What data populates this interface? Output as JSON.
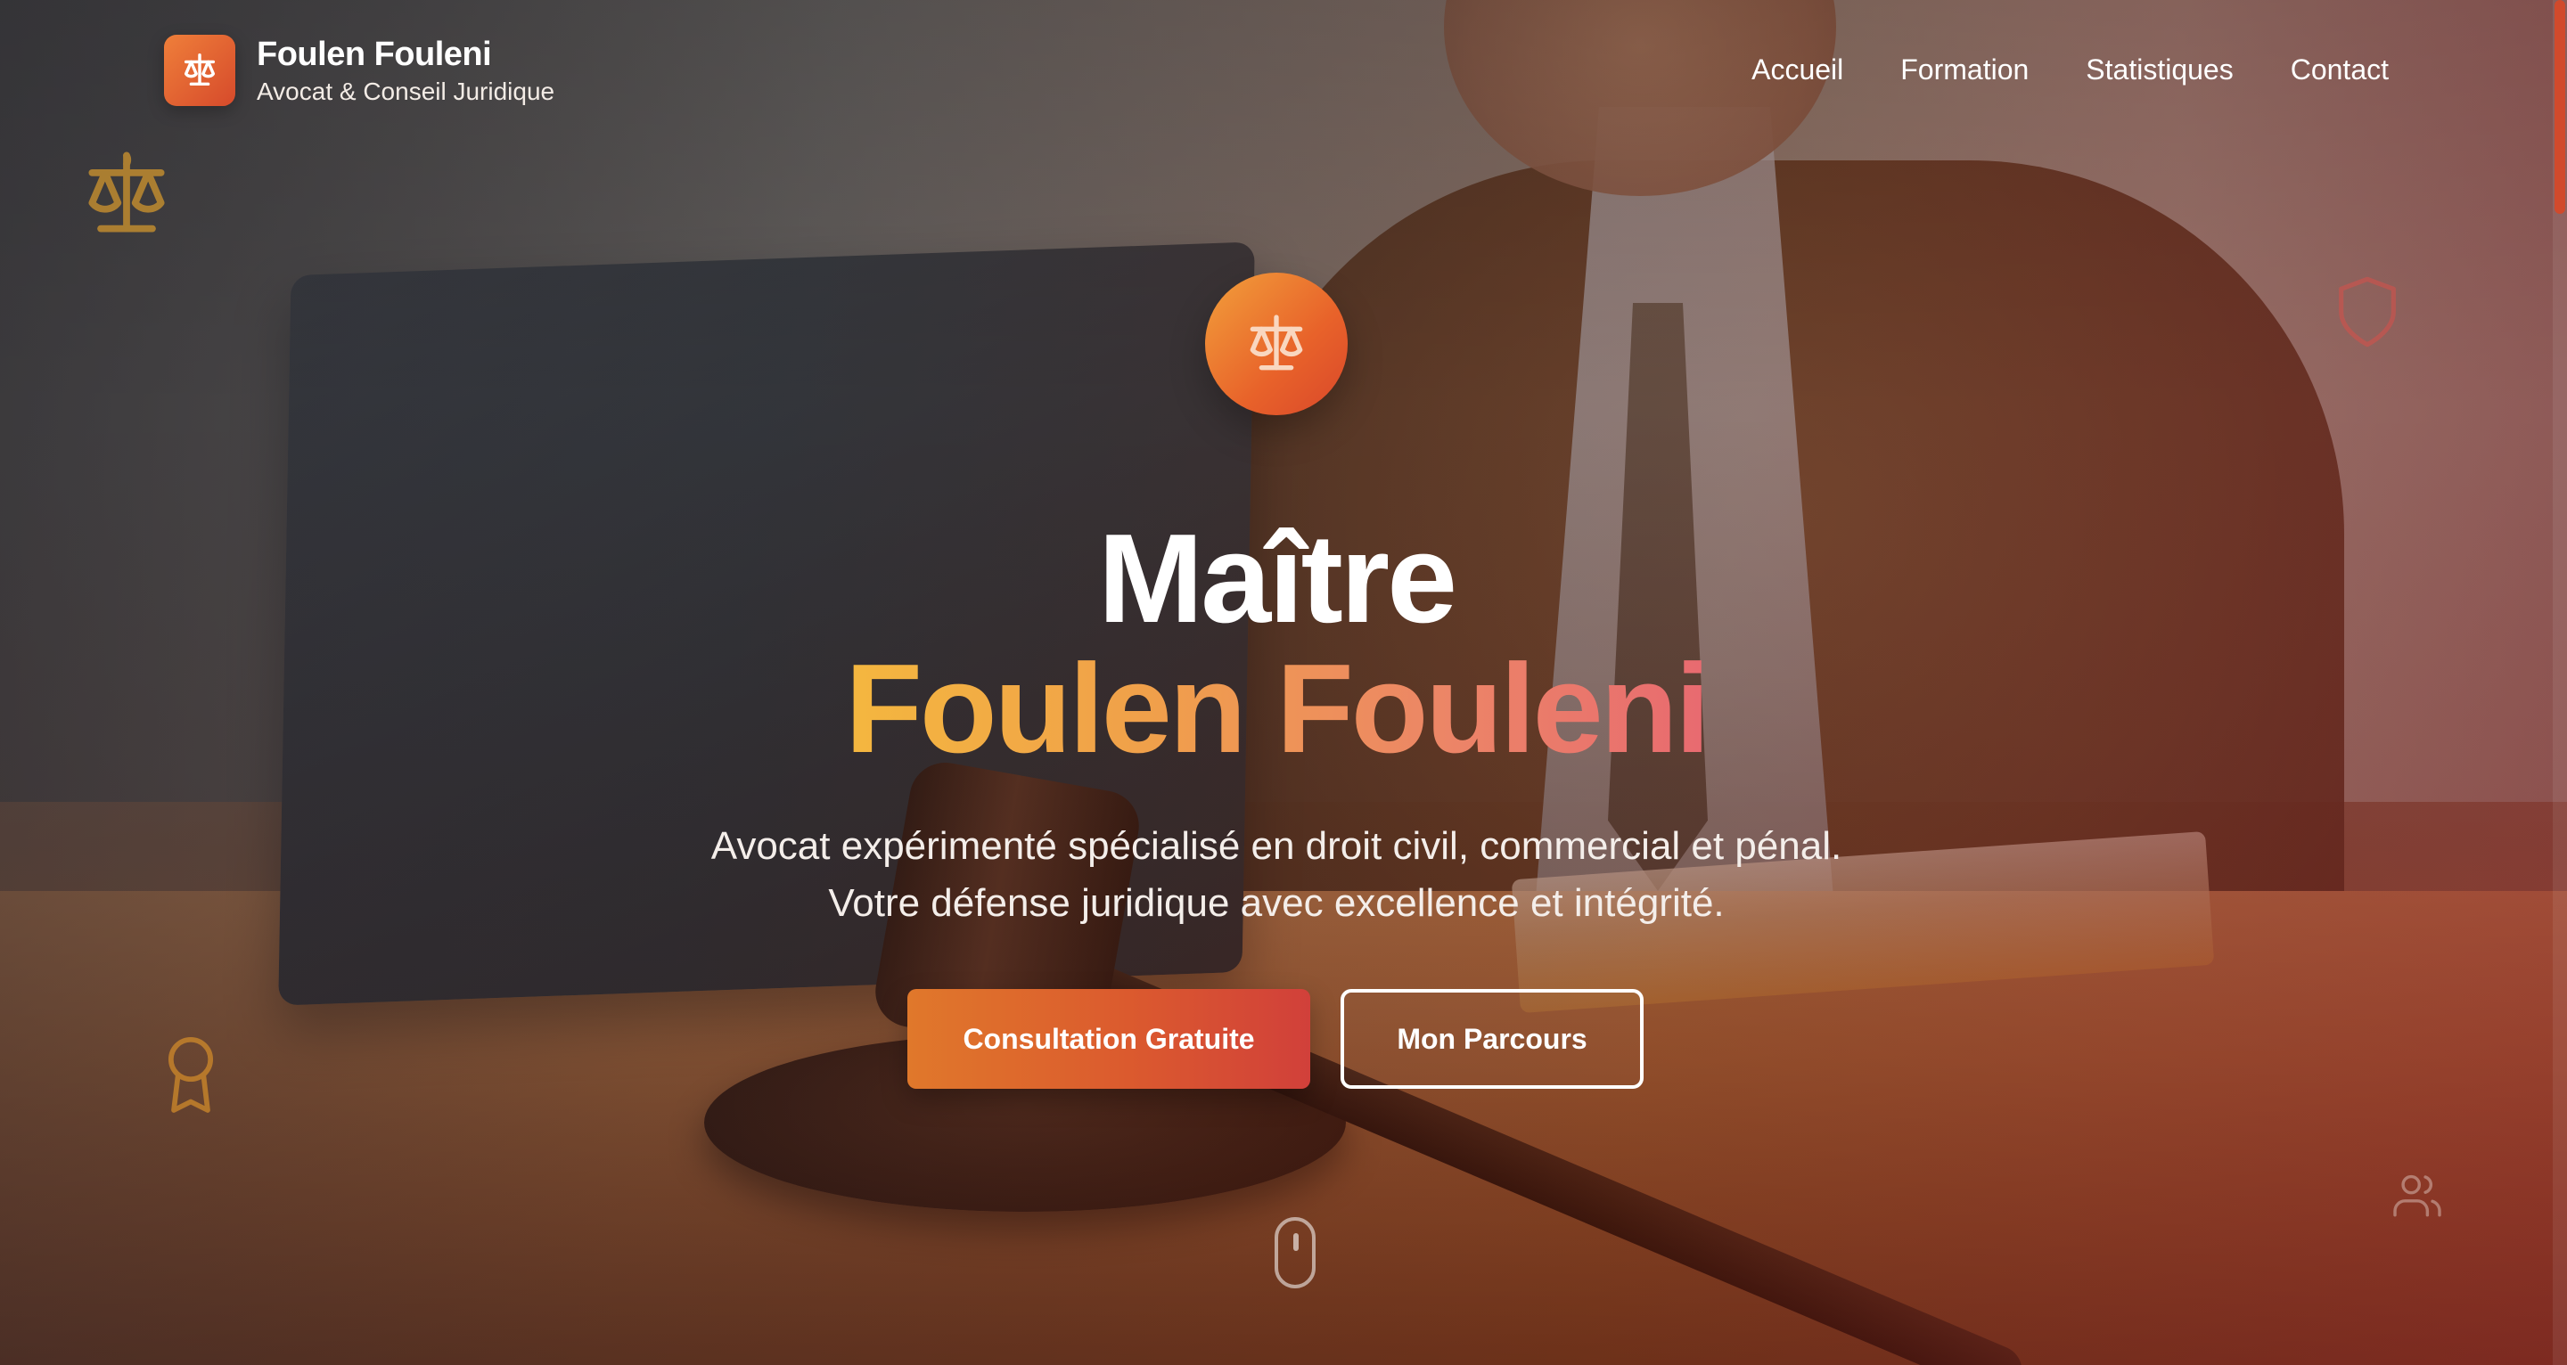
{
  "brand": {
    "name": "Foulen Fouleni",
    "subtitle": "Avocat & Conseil Juridique",
    "logo_icon": "scales-icon"
  },
  "nav": {
    "items": [
      {
        "label": "Accueil"
      },
      {
        "label": "Formation"
      },
      {
        "label": "Statistiques"
      },
      {
        "label": "Contact"
      }
    ]
  },
  "hero": {
    "badge_icon": "scales-icon",
    "title_line1": "Maître",
    "title_line2": "Foulen Fouleni",
    "description_line1": "Avocat expérimenté spécialisé en droit civil, commercial et pénal.",
    "description_line2": "Votre défense juridique avec excellence et intégrité.",
    "primary_button": "Consultation Gratuite",
    "secondary_button": "Mon Parcours"
  },
  "decorations": {
    "icons": [
      "scales-icon",
      "shield-icon",
      "award-icon",
      "users-icon",
      "mouse-scroll-icon"
    ]
  },
  "colors": {
    "accent_orange": "#e0782b",
    "accent_red": "#d1403a",
    "gold": "#f4b73f",
    "pink": "#e86a70"
  }
}
